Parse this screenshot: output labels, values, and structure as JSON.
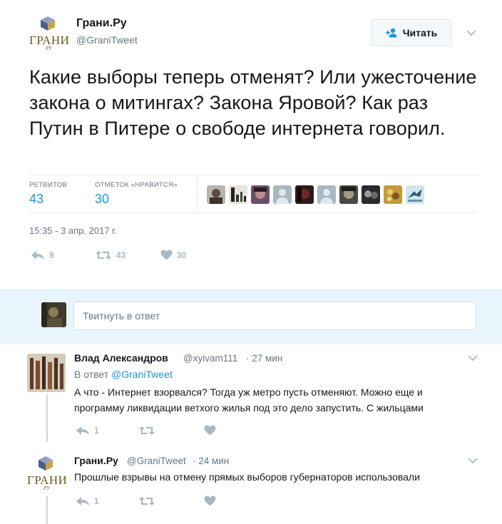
{
  "tweet": {
    "author": {
      "name": "Грани.Ру",
      "handle": "@GraniTweet",
      "logo_text": "ГРАНИ",
      "logo_sub": ".РУ"
    },
    "follow_label": "Читать",
    "text": "Какие выборы теперь отменят? Или ужесточение закона о митингах? Закона Яровой? Как раз Путин в Питере о свободе интернета говорил.",
    "stats": {
      "retweets_label": "РЕТВИТОВ",
      "retweets": "43",
      "likes_label": "ОТМЕТОК «НРАВИТСЯ»",
      "likes": "30"
    },
    "timestamp": "15:35 - 3 апр. 2017 г.",
    "actions": {
      "reply_count": "9",
      "retweet_count": "43",
      "like_count": "30"
    }
  },
  "compose": {
    "placeholder": "Твитнуть в ответ"
  },
  "replies": [
    {
      "name": "Влад Александров",
      "handle": "@xyivam111",
      "time": "· 27 мин",
      "reply_prefix": "В ответ",
      "reply_to": "@GraniTweet",
      "text_line1": "А что - Интернет взорвался? Тогда уж метро пусть отменяют. Можно еще и",
      "text_line2": "программу ликвидации ветхого жилья под это дело запустить. С жильцами",
      "reply_count": "1"
    },
    {
      "name": "Грани.Ру",
      "handle": "@GraniTweet",
      "time": "· 24 мин",
      "text_line1": "Прошлые взрывы на отмену прямых выборов губернаторов использовали",
      "reply_count": "1",
      "logo_text": "ГРАНИ",
      "logo_sub": ".РУ"
    }
  ],
  "colors": {
    "accent": "#1b95e0",
    "muted": "#657786",
    "icon": "#aab8c2",
    "reply_bg": "#e8f5fd"
  }
}
